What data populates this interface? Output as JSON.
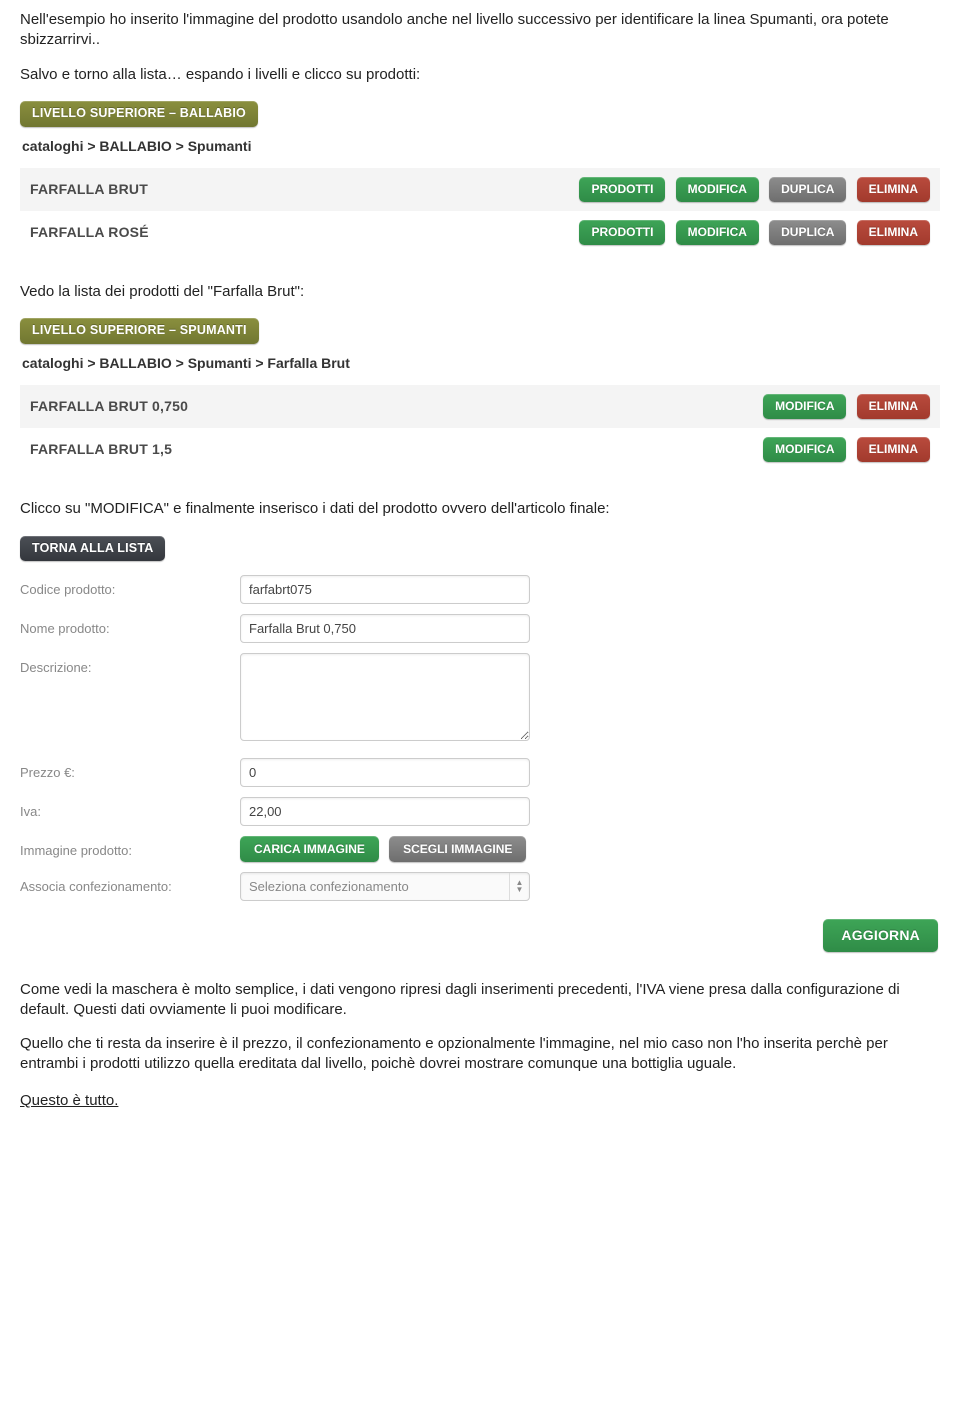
{
  "intro": {
    "p1": "Nell'esempio ho inserito l'immagine del prodotto usandolo anche nel livello successivo per identificare la linea Spumanti, ora potete sbizzarrirvi..",
    "p2": "Salvo e torno alla lista… espando i livelli e clicco su prodotti:"
  },
  "section1": {
    "badge": "LIVELLO SUPERIORE – BALLABIO",
    "breadcrumb": "cataloghi  >  BALLABIO  >  Spumanti",
    "rows": [
      {
        "name": "FARFALLA BRUT"
      },
      {
        "name": "FARFALLA ROSÉ"
      }
    ],
    "buttons": {
      "prodotti": "PRODOTTI",
      "modifica": "MODIFICA",
      "duplica": "DUPLICA",
      "elimina": "ELIMINA"
    }
  },
  "mid": {
    "p1": "Vedo la lista dei prodotti del \"Farfalla Brut\":"
  },
  "section2": {
    "badge": "LIVELLO SUPERIORE – SPUMANTI",
    "breadcrumb": "cataloghi  >  BALLABIO  >  Spumanti  >  Farfalla Brut",
    "rows": [
      {
        "name": "FARFALLA BRUT 0,750"
      },
      {
        "name": "FARFALLA BRUT 1,5"
      }
    ],
    "buttons": {
      "modifica": "MODIFICA",
      "elimina": "ELIMINA"
    }
  },
  "mid2": {
    "p1": "Clicco su \"MODIFICA\" e finalmente inserisco i dati del prodotto ovvero dell'articolo finale:"
  },
  "form": {
    "back_btn": "TORNA ALLA LISTA",
    "labels": {
      "codice": "Codice prodotto:",
      "nome": "Nome prodotto:",
      "descrizione": "Descrizione:",
      "prezzo": "Prezzo €:",
      "iva": "Iva:",
      "immagine": "Immagine prodotto:",
      "confezionamento": "Associa confezionamento:"
    },
    "values": {
      "codice": "farfabrt075",
      "nome": "Farfalla Brut 0,750",
      "descrizione": "",
      "prezzo": "0",
      "iva": "22,00",
      "confezionamento": "Seleziona confezionamento"
    },
    "img_btns": {
      "carica": "CARICA IMMAGINE",
      "scegli": "SCEGLI IMMAGINE"
    },
    "submit": "AGGIORNA"
  },
  "outro": {
    "p1": "Come vedi la maschera è molto semplice, i dati vengono ripresi dagli inserimenti precedenti, l'IVA viene presa dalla configurazione di default. Questi dati ovviamente li puoi modificare.",
    "p2": "Quello che ti resta da inserire è il prezzo, il confezionamento e opzionalmente l'immagine, nel mio caso non l'ho inserita perchè per entrambi i prodotti utilizzo quella ereditata dal livello, poichè dovrei mostrare comunque una bottiglia uguale.",
    "p3": "Questo è tutto."
  }
}
